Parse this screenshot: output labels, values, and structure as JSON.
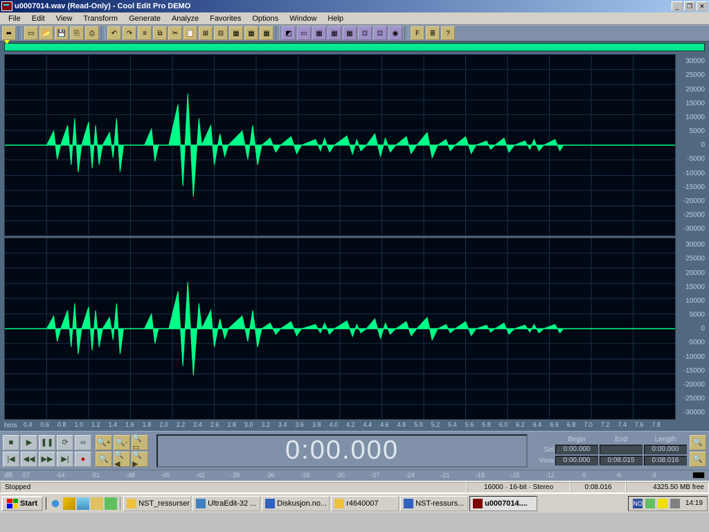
{
  "title": "u0007014.wav (Read-Only) - Cool Edit Pro DEMO",
  "menus": [
    "File",
    "Edit",
    "View",
    "Transform",
    "Generate",
    "Analyze",
    "Favorites",
    "Options",
    "Window",
    "Help"
  ],
  "amplitude_ticks": [
    "30000",
    "25000",
    "20000",
    "15000",
    "10000",
    "5000",
    "0",
    "-5000",
    "-10000",
    "-15000",
    "-20000",
    "-25000",
    "-30000"
  ],
  "time_ruler": {
    "label": "hms",
    "ticks": [
      "0.4",
      "0.6",
      "0.8",
      "1.0",
      "1.2",
      "1.4",
      "1.6",
      "1.8",
      "2.0",
      "2.2",
      "2.4",
      "2.6",
      "2.8",
      "3.0",
      "3.2",
      "3.4",
      "3.6",
      "3.8",
      "4.0",
      "4.2",
      "4.4",
      "4.6",
      "4.8",
      "5.0",
      "5.2",
      "5.4",
      "5.6",
      "5.8",
      "6.0",
      "6.2",
      "6.4",
      "6.6",
      "6.8",
      "7.0",
      "7.2",
      "7.4",
      "7.6",
      "7.8"
    ]
  },
  "bigtime": "0:00.000",
  "sel_headers": [
    "Begin",
    "End",
    "Length"
  ],
  "sel_rows": [
    {
      "label": "Sel",
      "vals": [
        "0:00.000",
        "",
        "0:00.000"
      ]
    },
    {
      "label": "View",
      "vals": [
        "0:00.000",
        "0:08.015",
        "0:08.016"
      ]
    }
  ],
  "db_ticks": [
    "-57",
    "-54",
    "-51",
    "-48",
    "-45",
    "-42",
    "-39",
    "-36",
    "-33",
    "-30",
    "-27",
    "-24",
    "-21",
    "-18",
    "-15",
    "-12",
    "-9",
    "-6",
    "-3"
  ],
  "db_label": "dB",
  "status": {
    "left": "Stopped",
    "rate": "16000 · 16-bit · Stereo",
    "dur": "0:08.016",
    "disk": "4325.50 MB free"
  },
  "taskbar": {
    "start": "Start",
    "buttons": [
      {
        "label": "NST_ressurser",
        "color": "#f0c040"
      },
      {
        "label": "UltraEdit-32 ...",
        "color": "#4080c0"
      },
      {
        "label": "Diskusjon.no...",
        "color": "#3060c0"
      },
      {
        "label": "r4640007",
        "color": "#f0c040"
      },
      {
        "label": "NST-ressurs...",
        "color": "#3060c0"
      },
      {
        "label": "u0007014....",
        "color": "#800000",
        "active": true
      }
    ],
    "tray": {
      "lang": "NO",
      "clock": "14:19"
    }
  }
}
